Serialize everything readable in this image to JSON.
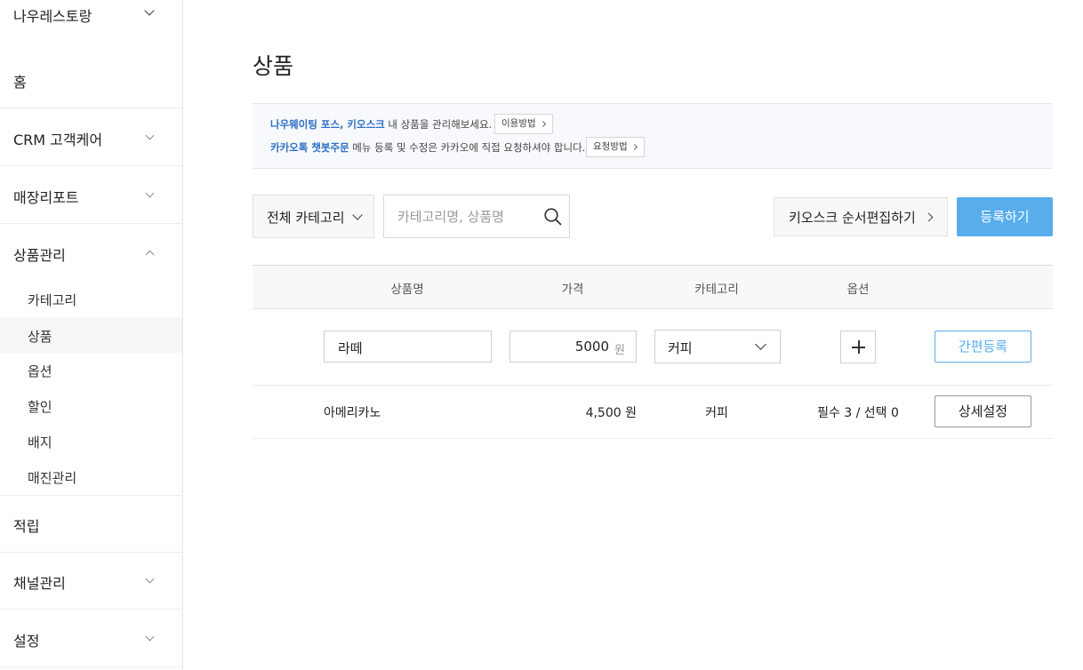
{
  "sidebar": {
    "store_name": "나우레스토랑",
    "menu": [
      {
        "label": "홈"
      },
      {
        "label": "CRM 고객케어"
      },
      {
        "label": "매장리포트"
      },
      {
        "label": "상품관리"
      },
      {
        "label": "적립"
      },
      {
        "label": "채널관리"
      },
      {
        "label": "설정"
      }
    ],
    "sub_menu": [
      {
        "label": "카테고리"
      },
      {
        "label": "상품",
        "active": true
      },
      {
        "label": "옵션"
      },
      {
        "label": "할인"
      },
      {
        "label": "배지"
      },
      {
        "label": "매진관리"
      }
    ]
  },
  "page": {
    "title": "상품"
  },
  "notice": {
    "line1_highlight": "나우웨이팅 포스, 키오스크",
    "line1_text": " 내 상품을 관리해보세요.",
    "line1_button": "이용방법",
    "line2_highlight": "카카오톡 챗봇주문",
    "line2_text": " 메뉴 등록 및 수정은 카카오에 직접 요청하셔야 합니다.",
    "line2_button": "요청방법"
  },
  "toolbar": {
    "category_filter": "전체 카테고리",
    "search_placeholder": "카테고리명, 상품명",
    "kiosk_button": "키오스크 순서편집하기",
    "register_button": "등록하기"
  },
  "table": {
    "headers": [
      "상품명",
      "가격",
      "카테고리",
      "옵션"
    ],
    "quick_add": {
      "name": "라떼",
      "price": "5000",
      "price_unit": "원",
      "category": "커피",
      "submit": "간편등록"
    },
    "rows": [
      {
        "name": "아메리카노",
        "price": "4,500 원",
        "category": "커피",
        "options": "필수 3 / 선택 0",
        "action": "상세설정"
      }
    ]
  },
  "colors": {
    "accent": "#58adec",
    "notice_highlight": "#2f6fc6"
  }
}
